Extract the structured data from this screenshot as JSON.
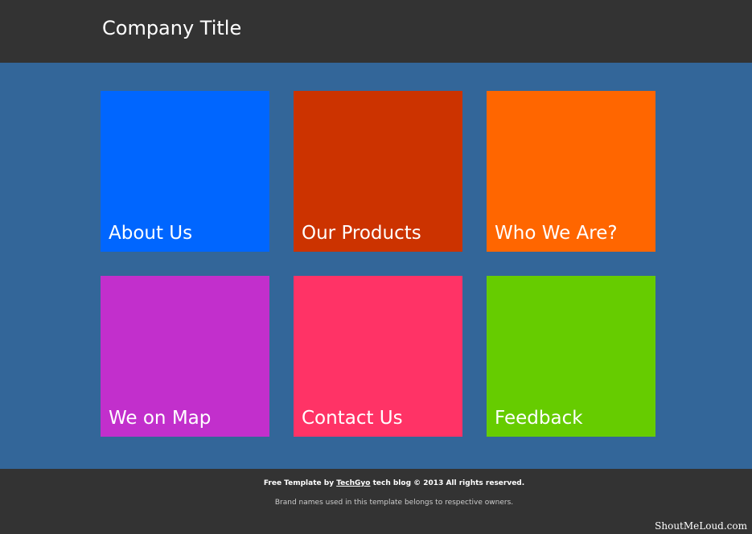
{
  "header": {
    "title": "Company Title"
  },
  "tiles": [
    {
      "label": "About Us",
      "color": "#0066ff"
    },
    {
      "label": "Our Products",
      "color": "#cc3300"
    },
    {
      "label": "Who We Are?",
      "color": "#ff6600"
    },
    {
      "label": "We on Map",
      "color": "#c22fcc"
    },
    {
      "label": "Contact Us",
      "color": "#ff3366"
    },
    {
      "label": "Feedback",
      "color": "#66cc00"
    }
  ],
  "footer": {
    "credit_prefix": "Free Template by",
    "credit_link": "TechGyo",
    "credit_suffix": "tech blog © 2013 All rights reserved.",
    "notice": "Brand names used in this template belongs to respective owners."
  },
  "watermark": "ShoutMeLoud.com",
  "colors": {
    "header_bg": "#333333",
    "main_bg": "#336699",
    "footer_bg": "#333333"
  }
}
